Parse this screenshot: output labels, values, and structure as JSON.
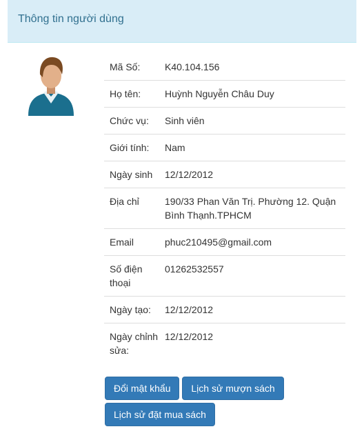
{
  "panel": {
    "title": "Thông tin người dùng"
  },
  "rows": [
    {
      "label": "Mã Số:",
      "value": "K40.104.156"
    },
    {
      "label": "Họ tên:",
      "value": "Huỳnh Nguyễn Châu Duy"
    },
    {
      "label": "Chức vụ:",
      "value": "Sinh viên"
    },
    {
      "label": "Giới tính:",
      "value": "Nam"
    },
    {
      "label": "Ngày sinh",
      "value": "12/12/2012"
    },
    {
      "label": "Địa chỉ",
      "value": "190/33 Phan Văn Trị. Phường 12. Quận Bình Thạnh.TPHCM"
    },
    {
      "label": "Email",
      "value": "phuc210495@gmail.com"
    },
    {
      "label": "Số điện thoại",
      "value": "01262532557"
    },
    {
      "label": "Ngày tạo:",
      "value": "12/12/2012"
    },
    {
      "label": "Ngày chỉnh sửa:",
      "value": "12/12/2012"
    }
  ],
  "buttons": {
    "change_password": "Đổi mật khẩu",
    "borrow_history": "Lịch sử mượn sách",
    "order_history": "Lịch sử đặt mua sách"
  },
  "colors": {
    "heading_bg": "#d9edf7",
    "heading_text": "#31708f",
    "primary": "#337ab7"
  },
  "avatar": {
    "icon": "user-avatar-icon"
  }
}
